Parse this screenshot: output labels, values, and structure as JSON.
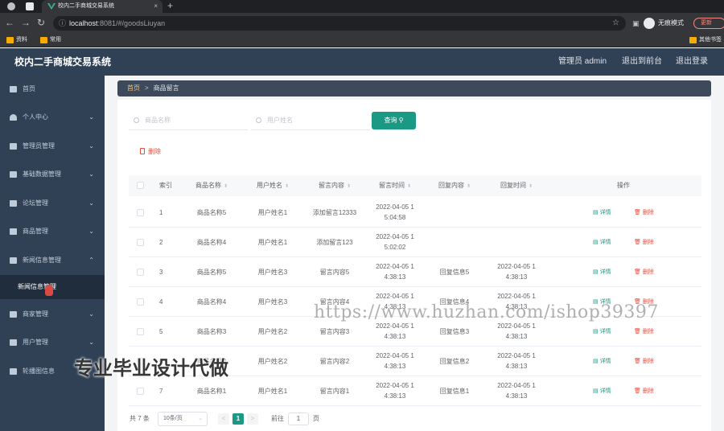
{
  "browser": {
    "tab_title": "校内二手商城交易系统",
    "tab_close": "×",
    "new_tab": "+",
    "url_host": "localhost",
    "url_path": ":8081/#/goodsLiuyan",
    "incognito_label": "无痕模式",
    "update_label": "更新",
    "bookmarks": [
      "资料",
      "常用"
    ],
    "other_bookmarks": "其他书签"
  },
  "header": {
    "title": "校内二手商城交易系统",
    "admin": "管理员 admin",
    "back_front": "退出到前台",
    "logout": "退出登录"
  },
  "sidebar": {
    "items": [
      {
        "label": "首页",
        "icon": "home-icon"
      },
      {
        "label": "个人中心",
        "icon": "user-icon"
      },
      {
        "label": "管理员管理",
        "icon": "list-icon"
      },
      {
        "label": "基础数据管理",
        "icon": "copy-icon"
      },
      {
        "label": "论坛管理",
        "icon": "send-icon"
      },
      {
        "label": "商品管理",
        "icon": "goods-icon"
      },
      {
        "label": "新闻信息管理",
        "icon": "news-icon"
      },
      {
        "label": "商家管理",
        "icon": "phone-icon"
      },
      {
        "label": "用户管理",
        "icon": "chart-icon"
      },
      {
        "label": "轮播图信息",
        "icon": "message-icon"
      }
    ],
    "active_sub": "新闻信息管理"
  },
  "breadcrumb": {
    "home": "首页",
    "sep": ">",
    "current": "商品留言"
  },
  "search": {
    "goods_placeholder": "商品名称",
    "user_placeholder": "用户姓名",
    "query_label": "查询"
  },
  "toolbar": {
    "delete_label": "删除"
  },
  "table": {
    "headers": [
      "索引",
      "商品名称",
      "用户姓名",
      "留言内容",
      "留言时间",
      "回复内容",
      "回复时间",
      "操作"
    ],
    "detail_label": "详情",
    "delete_label": "删除",
    "rows": [
      {
        "idx": "1",
        "goods": "商品名称5",
        "user": "用户姓名1",
        "content": "添加留言12333",
        "time1": "2022-04-05 1",
        "time2": "5:04:58",
        "reply": "",
        "rtime1": "",
        "rtime2": ""
      },
      {
        "idx": "2",
        "goods": "商品名称4",
        "user": "用户姓名1",
        "content": "添加留言123",
        "time1": "2022-04-05 1",
        "time2": "5:02:02",
        "reply": "",
        "rtime1": "",
        "rtime2": ""
      },
      {
        "idx": "3",
        "goods": "商品名称5",
        "user": "用户姓名3",
        "content": "留言内容5",
        "time1": "2022-04-05 1",
        "time2": "4:38:13",
        "reply": "回复信息5",
        "rtime1": "2022-04-05 1",
        "rtime2": "4:38:13"
      },
      {
        "idx": "4",
        "goods": "商品名称4",
        "user": "用户姓名3",
        "content": "留言内容4",
        "time1": "2022-04-05 1",
        "time2": "4:38:13",
        "reply": "回复信息4",
        "rtime1": "2022-04-05 1",
        "rtime2": "4:38:13"
      },
      {
        "idx": "5",
        "goods": "商品名称3",
        "user": "用户姓名2",
        "content": "留言内容3",
        "time1": "2022-04-05 1",
        "time2": "4:38:13",
        "reply": "回复信息3",
        "rtime1": "2022-04-05 1",
        "rtime2": "4:38:13"
      },
      {
        "idx": "6",
        "goods": "商品名称2",
        "user": "用户姓名2",
        "content": "留言内容2",
        "time1": "2022-04-05 1",
        "time2": "4:38:13",
        "reply": "回复信息2",
        "rtime1": "2022-04-05 1",
        "rtime2": "4:38:13"
      },
      {
        "idx": "7",
        "goods": "商品名称1",
        "user": "用户姓名1",
        "content": "留言内容1",
        "time1": "2022-04-05 1",
        "time2": "4:38:13",
        "reply": "回复信息1",
        "rtime1": "2022-04-05 1",
        "rtime2": "4:38:13"
      }
    ]
  },
  "pagination": {
    "total": "共 7 条",
    "page_size": "10条/页",
    "prev": "<",
    "current": "1",
    "next": ">",
    "goto_label": "前往",
    "goto_value": "1",
    "page_unit": "页"
  },
  "overlay": {
    "url_watermark": "https://www.huzhan.com/ishop39397",
    "promo_text": "专业毕业设计代做"
  },
  "colors": {
    "accent": "#1a9a85",
    "sidebar": "#304156",
    "danger": "#e74c3c"
  }
}
